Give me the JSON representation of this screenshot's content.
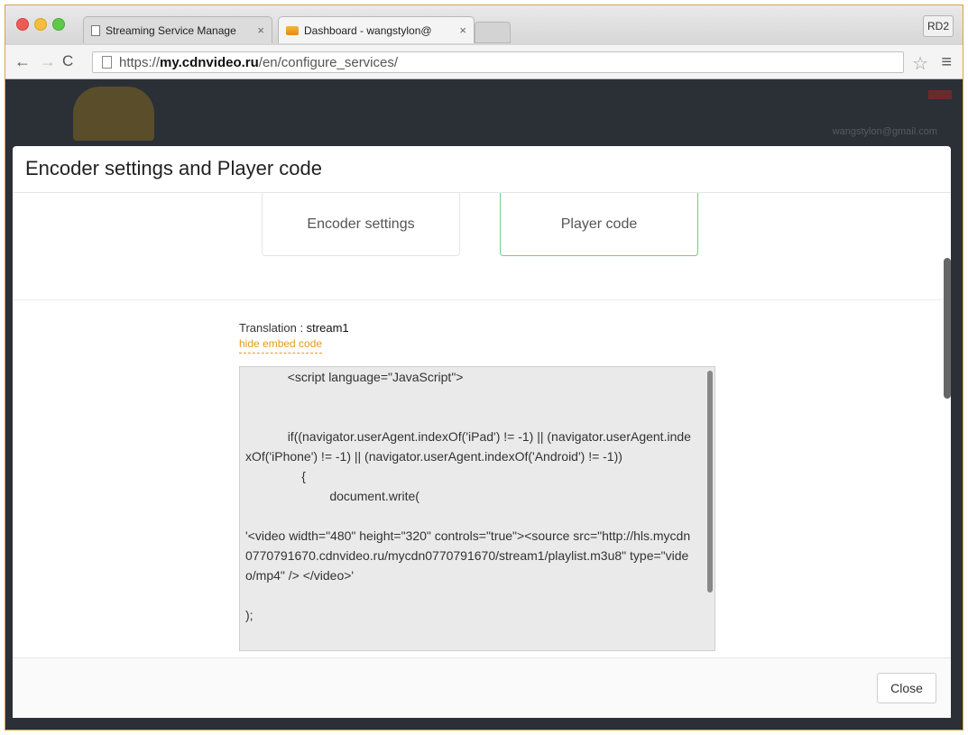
{
  "browser": {
    "tabs": [
      {
        "title": "Streaming Service Manage",
        "active": false
      },
      {
        "title": "Dashboard - wangstylon@",
        "active": true
      }
    ],
    "profile_label": "RD2",
    "url": {
      "scheme": "https://",
      "host": "my.cdnvideo.ru",
      "path": "/en/configure_services/"
    }
  },
  "page": {
    "user_email": "wangstylon@gmail.com"
  },
  "modal": {
    "title": "Encoder settings and Player code",
    "tabs": [
      {
        "label": "Encoder settings",
        "active": false
      },
      {
        "label": "Player code",
        "active": true
      }
    ],
    "translation_label": "Translation : ",
    "translation_value": "stream1",
    "hide_link": "hide embed code",
    "code": "            <script language=\"JavaScript\">\n\n\n            if((navigator.userAgent.indexOf('iPad') != -1) || (navigator.userAgent.indexOf('iPhone') != -1) || (navigator.userAgent.indexOf('Android') != -1))\n                {\n                        document.write(\n\n'<video width=\"480\" height=\"320\" controls=\"true\"><source src=\"http://hls.mycdn0770791670.cdnvideo.ru/mycdn0770791670/stream1/playlist.m3u8\" type=\"video/mp4\" /> </video>'\n\n);",
    "close_label": "Close"
  }
}
